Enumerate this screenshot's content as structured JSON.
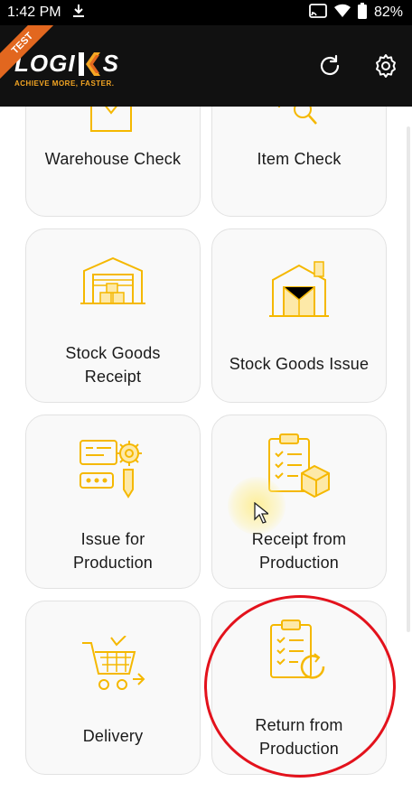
{
  "status_bar": {
    "time": "1:42 PM",
    "battery": "82%",
    "icons": [
      "download-icon",
      "cast-icon",
      "wifi-icon",
      "battery-icon"
    ]
  },
  "app_bar": {
    "badge": "TEST",
    "logo_left": "LOGI",
    "logo_right": "S",
    "tagline": "ACHIEVE MORE, FASTER.",
    "actions": [
      "refresh-icon",
      "settings-icon"
    ]
  },
  "tiles": [
    {
      "label": "Warehouse Check",
      "icon": "warehouse-check-icon"
    },
    {
      "label": "Item Check",
      "icon": "item-check-icon"
    },
    {
      "label": "Stock Goods Receipt",
      "icon": "stock-goods-receipt-icon"
    },
    {
      "label": "Stock Goods Issue",
      "icon": "stock-goods-issue-icon"
    },
    {
      "label": "Issue for Production",
      "icon": "issue-for-production-icon"
    },
    {
      "label": "Receipt from Production",
      "icon": "receipt-from-production-icon"
    },
    {
      "label": "Delivery",
      "icon": "delivery-cart-icon"
    },
    {
      "label": "Return from Production",
      "icon": "return-from-production-icon"
    }
  ],
  "colors": {
    "accent": "#f5b800",
    "brand_orange": "#e2671f",
    "appbar": "#111111",
    "tile_bg": "#f9f9f9",
    "annotation_red": "#e3121c"
  }
}
